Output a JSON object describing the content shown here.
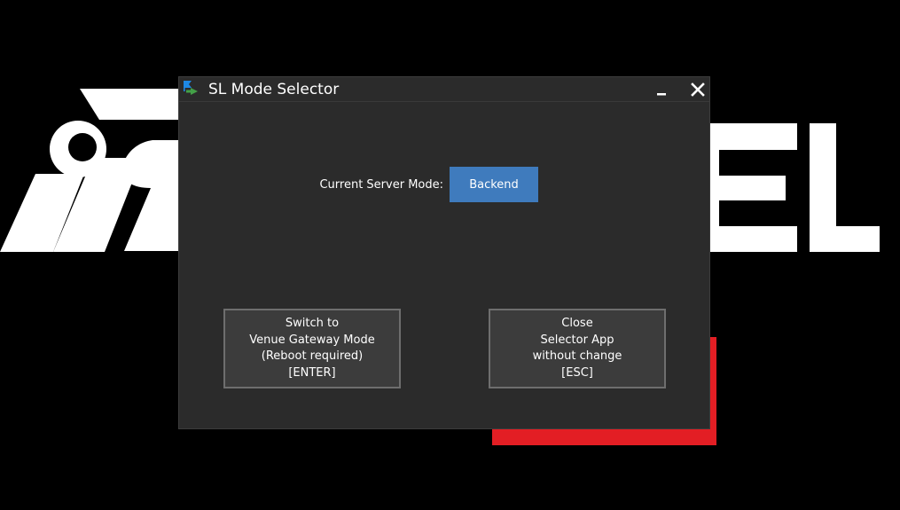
{
  "background": {
    "logo_color": "#ffffff",
    "accent_color": "#e31e24"
  },
  "window": {
    "title": "SL Mode Selector",
    "icon": "app-flag-arrows-icon",
    "minimize_icon": "minimize-icon",
    "close_icon": "close-icon"
  },
  "main": {
    "mode_label": "Current Server Mode:",
    "mode_value": "Backend",
    "mode_color": "#3f7bbd"
  },
  "buttons": {
    "switch": {
      "lines": [
        "Switch to",
        "Venue Gateway Mode",
        "(Reboot required)",
        "[ENTER]"
      ]
    },
    "close": {
      "lines": [
        "Close",
        "Selector App",
        "without change",
        "[ESC]"
      ]
    }
  }
}
